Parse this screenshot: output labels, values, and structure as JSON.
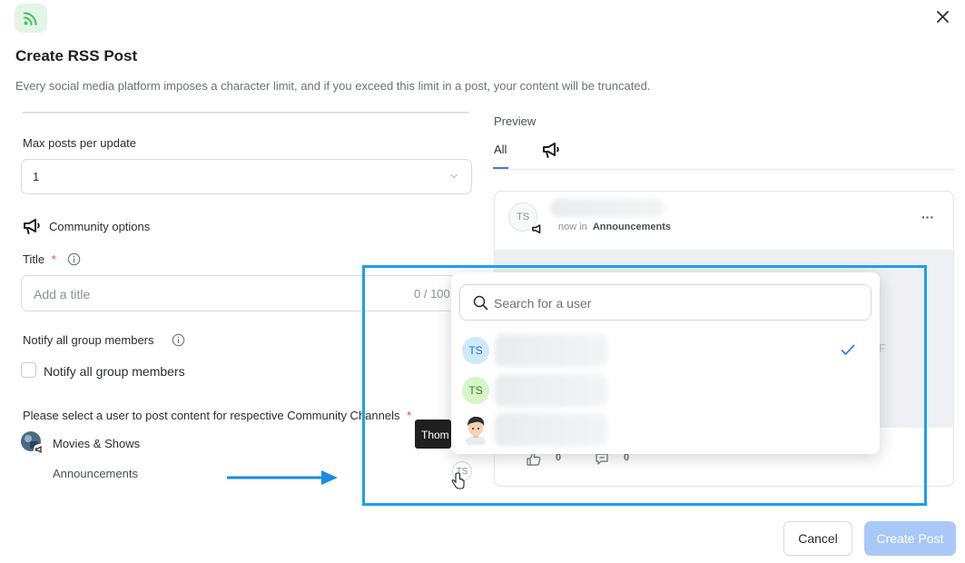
{
  "header": {
    "title": "Create RSS Post",
    "subtitle": "Every social media platform imposes a character limit, and if you exceed this limit in a post, your content will be truncated."
  },
  "form": {
    "max_posts_label": "Max posts per update",
    "max_posts_value": "1",
    "community_options_label": "Community options",
    "title_label": "Title",
    "title_required_mark": "*",
    "title_placeholder": "Add a title",
    "title_counter": "0 / 100",
    "notify_label": "Notify all group members",
    "notify_checkbox_label": "Notify all group members",
    "select_user_label": "Please select a user to post content for respective Community Channels",
    "select_user_required_mark": "*",
    "community_name": "Movies & Shows",
    "channel_name": "Announcements",
    "channel_avatar_initials": "TS"
  },
  "preview": {
    "label": "Preview",
    "tabs": [
      {
        "label": "All",
        "active": true
      }
    ],
    "card": {
      "avatar_initials": "TS",
      "meta_prefix": "now in",
      "channel": "Announcements",
      "more_label": "···",
      "likes_count": "0",
      "comments_count": "0",
      "partial_letter": "F"
    }
  },
  "user_dropdown": {
    "search_placeholder": "Search for a user",
    "users": [
      {
        "initials": "TS",
        "avatar_color": "#cde9fb",
        "text_color": "#3a6f96",
        "selected": true
      },
      {
        "initials": "TS",
        "avatar_color": "#d6f5c8",
        "text_color": "#3d7a2c",
        "selected": false
      },
      {
        "initials": "",
        "avatar_type": "photo",
        "selected": false
      }
    ]
  },
  "tooltip": {
    "text": "Thom"
  },
  "footer": {
    "cancel_label": "Cancel",
    "create_label": "Create Post"
  },
  "colors": {
    "accent": "#3b7ddd",
    "highlight": "#1aa0f0",
    "rss_green": "#3cc35a",
    "required": "#e5484d",
    "primary_disabled": "#a9c8f8"
  }
}
